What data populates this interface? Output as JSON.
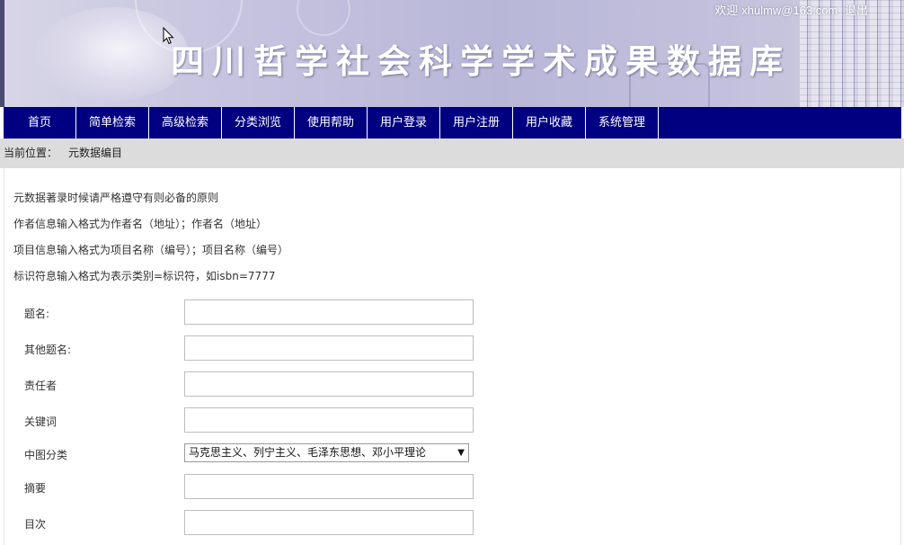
{
  "header": {
    "title": "四川哲学社会科学学术成果数据库",
    "welcome": "欢迎",
    "user_email": "xhulmw@163.com",
    "logout_label": "退出"
  },
  "nav": {
    "items": [
      {
        "label": "首页"
      },
      {
        "label": "简单检索"
      },
      {
        "label": "高级检索"
      },
      {
        "label": "分类浏览"
      },
      {
        "label": "使用帮助"
      },
      {
        "label": "用户登录"
      },
      {
        "label": "用户注册"
      },
      {
        "label": "用户收藏"
      },
      {
        "label": "系统管理"
      }
    ]
  },
  "breadcrumb": {
    "prefix": "当前位置：",
    "current": "元数据编目"
  },
  "notes": [
    "元数据著录时候请严格遵守有则必备的原则",
    "作者信息输入格式为作者名（地址）；作者名（地址）",
    "项目信息输入格式为项目名称（编号）；项目名称（编号）",
    "标识符息输入格式为表示类别=标识符，如isbn=7777"
  ],
  "form": {
    "title_label": "题名:",
    "title_value": "",
    "other_title_label": "其他题名:",
    "other_title_value": "",
    "responsible_label": "责任者",
    "responsible_value": "",
    "keywords_label": "关键词",
    "keywords_value": "",
    "classification_label": "中图分类",
    "classification_selected": "马克思主义、列宁主义、毛泽东思想、邓小平理论",
    "abstract_label": "摘要",
    "abstract_value": "",
    "toc_label": "目次",
    "toc_value": ""
  },
  "icons": {
    "cursor": "mouse-pointer-icon",
    "select_arrow": "chevron-down-icon"
  },
  "colors": {
    "nav_background": "#000080",
    "breadcrumb_background": "#dcdcdc"
  }
}
